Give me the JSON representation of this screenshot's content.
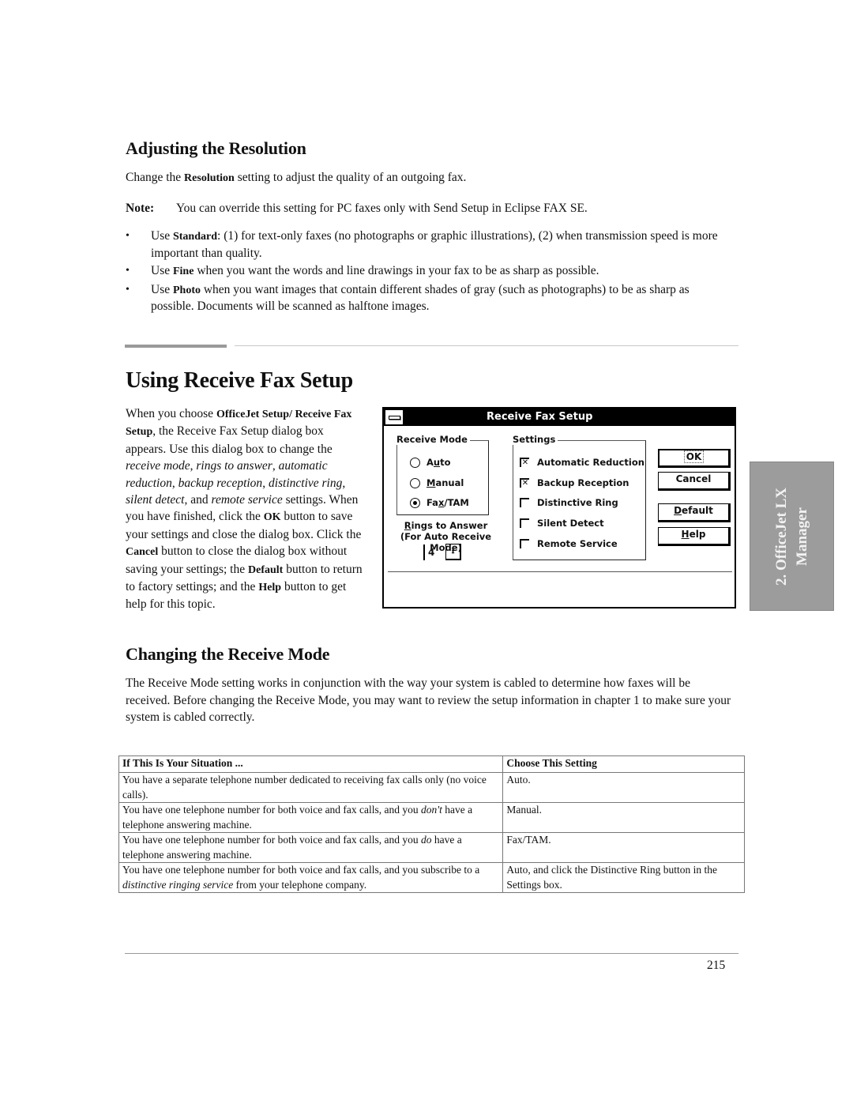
{
  "resolution_section": {
    "heading": "Adjusting the Resolution",
    "intro": {
      "pre": "Change the ",
      "bold": "Resolution",
      "post": " setting to adjust the quality of an outgoing fax."
    },
    "note": {
      "label": "Note:",
      "text": "You can override this setting for PC faxes only with Send Setup in Eclipse FAX SE."
    },
    "bullets": [
      {
        "pre": "Use ",
        "bold": "Standard",
        "post": ": (1) for text-only faxes (no photographs or graphic illustrations), (2) when transmission speed is more important than quality."
      },
      {
        "pre": "Use ",
        "bold": "Fine",
        "post": " when you want the words and line drawings in your fax to be as sharp as possible."
      },
      {
        "pre": "Use ",
        "bold": "Photo",
        "post": " when you want images that contain different shades of gray (such as photographs) to be as sharp as possible. Documents will be scanned as halftone images."
      }
    ],
    "bullet_glyph": "•"
  },
  "receive_setup_section": {
    "heading": "Using Receive Fax Setup",
    "paragraph": {
      "t1": "When you choose ",
      "b1": "OfficeJet Setup/ Receive Fax Setup",
      "t2": ", the Receive Fax Setup dialog box appears. Use this dialog box to change the ",
      "i1": "receive mode",
      "t3": ", ",
      "i2": "rings to answer",
      "t4": ", ",
      "i3": "automatic reduction",
      "t5": ", ",
      "i4": "backup reception",
      "t6": ", ",
      "i5": "distinctive ring",
      "t7": ", ",
      "i6": "silent detect",
      "t8": ", and ",
      "i7": "remote service",
      "t9": " settings. When you have finished, click the ",
      "b2": "OK",
      "t10": " button to save your settings and close the dialog box. Click the ",
      "b3": "Cancel",
      "t11": " button to close the dialog box without saving your settings; the ",
      "b4": "Default",
      "t12": " button to return to factory settings; and the ",
      "b5": "Help",
      "t13": " button to get help for this topic."
    }
  },
  "dialog": {
    "title": "Receive Fax Setup",
    "receive_mode": {
      "legend": "Receive Mode",
      "options": [
        {
          "label_pre": "A",
          "label_u": "u",
          "label_post": "to",
          "selected": false
        },
        {
          "label_pre": "",
          "label_u": "M",
          "label_post": "anual",
          "selected": false
        },
        {
          "label_pre": "Fa",
          "label_u": "x",
          "label_post": "/TAM",
          "selected": true
        }
      ]
    },
    "rings": {
      "label_u": "R",
      "label_rest": "ings to Answer",
      "sublabel": "(For Auto Receive Mode)",
      "value": "4",
      "arrow_glyph": "⭳"
    },
    "settings": {
      "legend": "Settings",
      "items": [
        {
          "label": "Automatic Reduction",
          "checked": true
        },
        {
          "label": "Backup Reception",
          "checked": true
        },
        {
          "label": "Distinctive Ring",
          "checked": false
        },
        {
          "label": "Silent Detect",
          "checked": false
        },
        {
          "label": "Remote Service",
          "checked": false
        }
      ],
      "check_glyph": "✕"
    },
    "buttons": {
      "ok": "OK",
      "cancel": "Cancel",
      "default_u": "D",
      "default_rest": "efault",
      "help_u": "H",
      "help_rest": "elp"
    }
  },
  "side_tab": {
    "line1": "2. OfficeJet LX",
    "line2": "Manager"
  },
  "receive_mode_section": {
    "heading": "Changing the Receive Mode",
    "paragraph": "The Receive Mode setting works in conjunction with the way your system is cabled to determine how faxes will be received. Before changing the Receive Mode, you may want to review the setup information in chapter 1 to make sure your system is cabled correctly.",
    "table": {
      "headers": [
        "If This Is Your Situation ...",
        "Choose This Setting"
      ],
      "rows": [
        {
          "situation": {
            "pre": "You have a separate telephone number dedicated to receiving fax calls only (no voice calls).",
            "ital": "",
            "post": ""
          },
          "setting": "Auto."
        },
        {
          "situation": {
            "pre": "You have one telephone number for both voice and fax calls, and you ",
            "ital": "don't",
            "post": " have a telephone answering machine."
          },
          "setting": "Manual."
        },
        {
          "situation": {
            "pre": "You have one telephone number for both voice and fax calls, and you ",
            "ital": "do",
            "post": " have a telephone answering machine."
          },
          "setting": "Fax/TAM."
        },
        {
          "situation": {
            "pre": "You have one telephone number for both voice and fax calls, and you subscribe to a ",
            "ital": "distinctive ringing service",
            "post": " from your telephone company."
          },
          "setting": "Auto, and click the Distinctive Ring button in the Settings box."
        }
      ]
    }
  },
  "footer": {
    "page_number": "215"
  }
}
